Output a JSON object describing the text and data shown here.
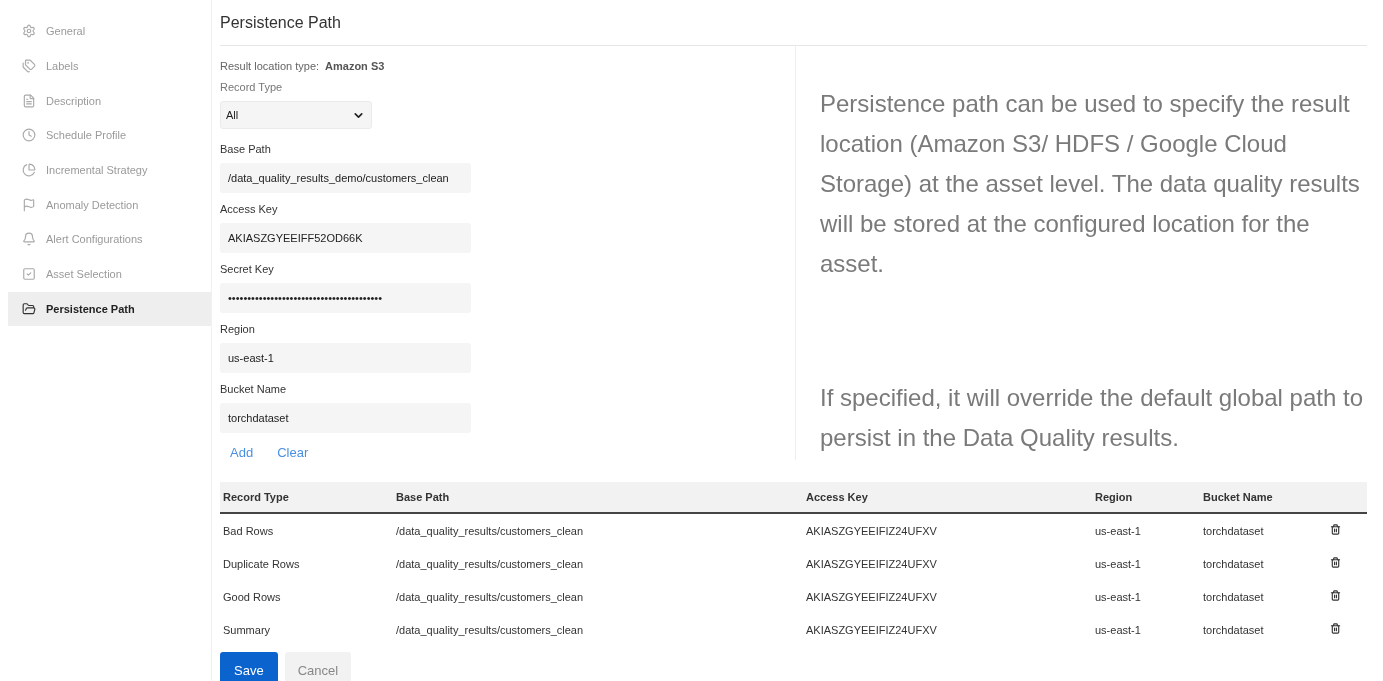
{
  "sidebar": {
    "items": [
      {
        "label": "General",
        "selected": false
      },
      {
        "label": "Labels",
        "selected": false
      },
      {
        "label": "Description",
        "selected": false
      },
      {
        "label": "Schedule Profile",
        "selected": false
      },
      {
        "label": "Incremental Strategy",
        "selected": false
      },
      {
        "label": "Anomaly Detection",
        "selected": false
      },
      {
        "label": "Alert Configurations",
        "selected": false
      },
      {
        "label": "Asset Selection",
        "selected": false
      },
      {
        "label": "Persistence Path",
        "selected": true
      }
    ]
  },
  "title": "Persistence Path",
  "form": {
    "location_label": "Result location type:",
    "location_value": "Amazon S3",
    "record_type": {
      "label": "Record Type",
      "value": "All"
    },
    "fields": [
      {
        "label": "Base Path",
        "value": "/data_quality_results_demo/customers_clean"
      },
      {
        "label": "Access Key",
        "value": "AKIASZGYEEIFF52OD66K"
      },
      {
        "label": "Secret Key",
        "value": "••••••••••••••••••••••••••••••••••••••••"
      },
      {
        "label": "Region",
        "value": "us-east-1"
      },
      {
        "label": "Bucket Name",
        "value": "torchdataset"
      }
    ],
    "links": [
      "Add",
      "Clear"
    ]
  },
  "help": [
    "Persistence path can be used to specify the result location (Amazon S3/ HDFS / Google Cloud Storage) at the asset level. The data quality results will be stored at the configured location for the asset.",
    "If specified, it will override the default global path to persist in the Data Quality results."
  ],
  "table": {
    "columns": [
      "Record Type",
      "Base Path",
      "Access Key",
      "Region",
      "Bucket Name"
    ],
    "rows": [
      [
        "Bad Rows",
        "/data_quality_results/customers_clean",
        "AKIASZGYEEIFIZ24UFXV",
        "us-east-1",
        "torchdataset"
      ],
      [
        "Duplicate Rows",
        "/data_quality_results/customers_clean",
        "AKIASZGYEEIFIZ24UFXV",
        "us-east-1",
        "torchdataset"
      ],
      [
        "Good Rows",
        "/data_quality_results/customers_clean",
        "AKIASZGYEEIFIZ24UFXV",
        "us-east-1",
        "torchdataset"
      ],
      [
        "Summary",
        "/data_quality_results/customers_clean",
        "AKIASZGYEEIFIZ24UFXV",
        "us-east-1",
        "torchdataset"
      ]
    ]
  },
  "buttons": {
    "save": "Save",
    "cancel": "Cancel"
  }
}
